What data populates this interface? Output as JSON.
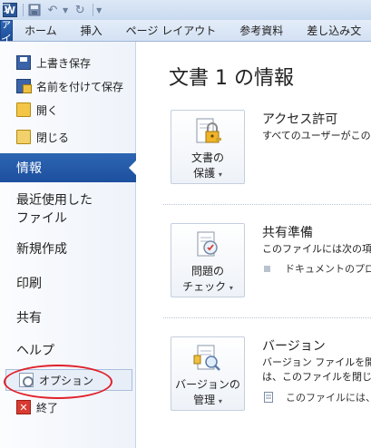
{
  "window": {
    "app_icon": "word-icon",
    "app_letter": "W",
    "qa_icons": [
      "save-icon",
      "undo-icon",
      "redo-icon",
      "customize-icon"
    ]
  },
  "ribbon": {
    "file_tab": "ファイル",
    "tabs": [
      "ホーム",
      "挿入",
      "ページ レイアウト",
      "参考資料",
      "差し込み文"
    ]
  },
  "backstage": {
    "commands": [
      {
        "label": "上書き保存",
        "icon": "save-icon"
      },
      {
        "label": "名前を付けて保存",
        "icon": "save-as-icon"
      },
      {
        "label": "開く",
        "icon": "open-folder-icon"
      },
      {
        "label": "閉じる",
        "icon": "close-folder-icon"
      }
    ],
    "nav": {
      "info": "情報",
      "recent_line1": "最近使用した",
      "recent_line2": "ファイル",
      "new": "新規作成",
      "print": "印刷",
      "share": "共有",
      "help": "ヘルプ",
      "options": "オプション",
      "exit": "終了"
    }
  },
  "info_panel": {
    "title": "文書 1 の情報",
    "sections": [
      {
        "button_line1": "文書の",
        "button_line2": "保護",
        "title": "アクセス許可",
        "desc": "すべてのユーザーがこの文",
        "icon": "lock-icon"
      },
      {
        "button_line1": "問題の",
        "button_line2": "チェック",
        "title": "共有準備",
        "desc": "このファイルには次の項目",
        "bullet": "ドキュメントのプロパ",
        "icon": "inspect-document-icon"
      },
      {
        "button_line1": "バージョンの",
        "button_line2": "管理",
        "title": "バージョン",
        "desc1": "バージョン ファイルを開い",
        "desc2": "は、このファイルを閉じた",
        "bullet": "このファイルには、前",
        "icon": "manage-versions-icon"
      }
    ]
  },
  "colors": {
    "accent": "#1f4f99",
    "highlight": "#e0202a"
  }
}
